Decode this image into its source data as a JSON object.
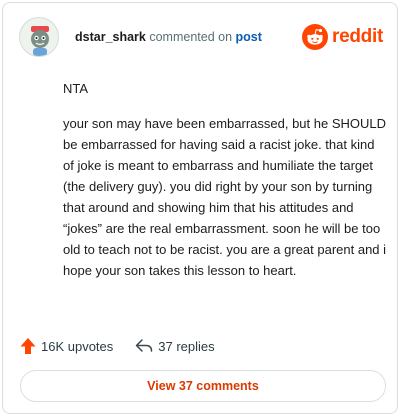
{
  "header": {
    "username": "dstar_shark",
    "action_text": "commented on",
    "target_link": "post",
    "brand_name": "reddit"
  },
  "comment": {
    "first_line": "NTA",
    "body": "your son may have been embarrassed, but he SHOULD be embarrassed for having said a racist joke. that kind of joke is meant to embarrass and humiliate the target (the delivery guy). you did right by your son by turning that around and showing him that his attitudes and “jokes” are the real embarrassment. soon he will be too old to teach not to be racist. you are a great parent and i hope your son takes this lesson to heart."
  },
  "footer": {
    "upvotes": "16K upvotes",
    "replies": "37 replies",
    "view_button": "View 37 comments"
  },
  "colors": {
    "brand": "#ff4500",
    "link": "#0a5db0",
    "view_button_text": "#d93a00"
  },
  "icons": {
    "avatar": "avatar-icon",
    "brand": "reddit-logo-icon",
    "upvote": "upvote-arrow-icon",
    "reply": "reply-arrow-icon"
  }
}
